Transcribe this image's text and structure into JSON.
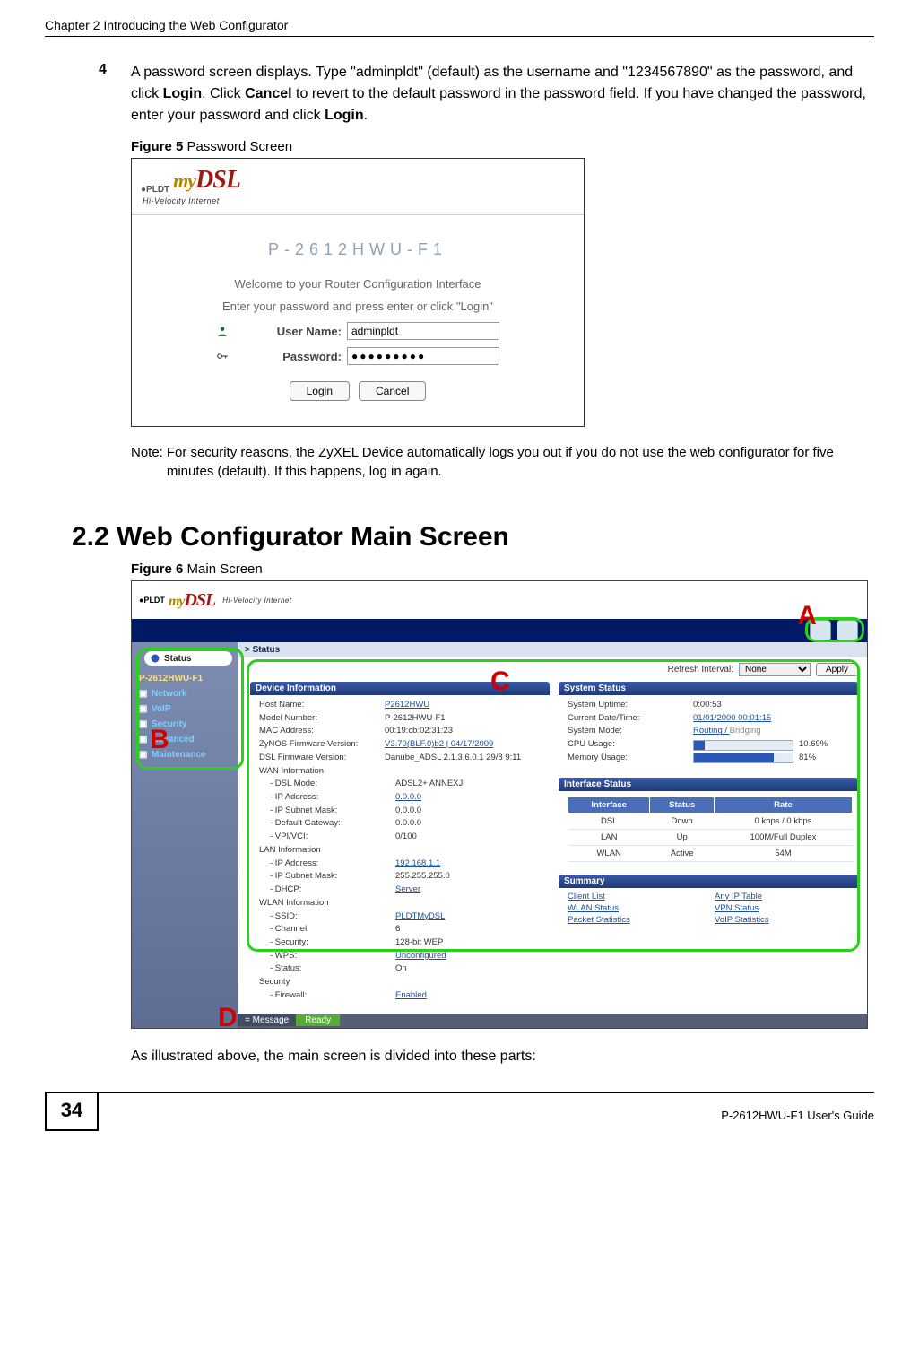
{
  "running_head": "Chapter 2 Introducing the Web Configurator",
  "step": {
    "num": "4",
    "text_before_login": "A password screen displays. Type \"adminpldt\" (default) as the username and \"1234567890\" as the password, and click ",
    "login_word": "Login",
    "text_mid": ". Click ",
    "cancel_word": "Cancel",
    "text_after_cancel": " to revert to the default password in the password field. If you have changed the password, enter your password and click ",
    "login_word_2": "Login",
    "period": "."
  },
  "figure5": {
    "label_bold": "Figure 5",
    "label_rest": "   Password Screen",
    "pldt": "●PLDT",
    "mydsl_my": "my",
    "mydsl_dsl": "DSL",
    "tagline": "Hi-Velocity Internet",
    "model": "P-2612HWU-F1",
    "welcome": "Welcome to your Router Configuration Interface",
    "instruction": "Enter your password and press enter or click \"Login\"",
    "user_label": "User Name:",
    "user_value": "adminpldt",
    "pass_label": "Password:",
    "pass_value": "●●●●●●●●●",
    "login_btn": "Login",
    "cancel_btn": "Cancel"
  },
  "note": {
    "label": "Note: ",
    "text": "For security reasons, the ZyXEL Device automatically logs you out if you do not use the web configurator for five minutes (default). If this happens, log in again."
  },
  "section_heading": "2.2  Web Configurator Main Screen",
  "figure6": {
    "label_bold": "Figure 6",
    "label_rest": "   Main Screen",
    "breadcrumb": "> Status",
    "refresh_label": "Refresh Interval:",
    "refresh_value": "None",
    "apply": "Apply",
    "sidebar": {
      "status": "Status",
      "model": "P-2612HWU-F1",
      "items": [
        "Network",
        "VoIP",
        "Security",
        "Advanced",
        "Maintenance"
      ]
    },
    "device_info": {
      "title": "Device Information",
      "rows": [
        {
          "label": "Host Name:",
          "value": "P2612HWU",
          "link": true
        },
        {
          "label": "Model Number:",
          "value": "P-2612HWU-F1"
        },
        {
          "label": "MAC Address:",
          "value": "00:19:cb:02:31:23"
        },
        {
          "label": "ZyNOS Firmware Version:",
          "value": "V3.70(BLF.0)b2 | 04/17/2009",
          "link": true
        },
        {
          "label": "DSL Firmware Version:",
          "value": "Danube_ADSL 2.1.3.6.0.1 29/8 9:11"
        },
        {
          "label": "WAN Information"
        },
        {
          "label": "- DSL Mode:",
          "value": "ADSL2+ ANNEXJ",
          "indent": true
        },
        {
          "label": "- IP Address:",
          "value": "0.0.0.0",
          "indent": true,
          "link": true
        },
        {
          "label": "- IP Subnet Mask:",
          "value": "0.0.0.0",
          "indent": true
        },
        {
          "label": "- Default Gateway:",
          "value": "0.0.0.0",
          "indent": true
        },
        {
          "label": "- VPI/VCI:",
          "value": "0/100",
          "indent": true
        },
        {
          "label": "LAN Information"
        },
        {
          "label": "- IP Address:",
          "value": "192.168.1.1",
          "indent": true,
          "link": true
        },
        {
          "label": "- IP Subnet Mask:",
          "value": "255.255.255.0",
          "indent": true
        },
        {
          "label": "- DHCP:",
          "value": "Server",
          "indent": true,
          "link": true
        },
        {
          "label": "WLAN Information"
        },
        {
          "label": "- SSID:",
          "value": "PLDTMyDSL",
          "indent": true,
          "link": true
        },
        {
          "label": "- Channel:",
          "value": "6",
          "indent": true
        },
        {
          "label": "- Security:",
          "value": "128-bit WEP",
          "indent": true
        },
        {
          "label": "- WPS:",
          "value": "Unconfigured",
          "indent": true,
          "link": true
        },
        {
          "label": "- Status:",
          "value": "On",
          "indent": true
        },
        {
          "label": "Security"
        },
        {
          "label": "- Firewall:",
          "value": "Enabled",
          "indent": true,
          "link": true
        }
      ]
    },
    "system_status": {
      "title": "System Status",
      "rows": [
        {
          "label": "System Uptime:",
          "value": "0:00:53"
        },
        {
          "label": "Current Date/Time:",
          "value": "01/01/2000 00:01:15",
          "link": true
        },
        {
          "label": "System Mode:",
          "value": "Routing / Bridging",
          "split": true
        },
        {
          "label": "CPU Usage:",
          "value": "10.69%",
          "bar": 11
        },
        {
          "label": "Memory Usage:",
          "value": "81%",
          "bar": 81
        }
      ]
    },
    "interface_status": {
      "title": "Interface Status",
      "headers": [
        "Interface",
        "Status",
        "Rate"
      ],
      "rows": [
        [
          "DSL",
          "Down",
          "0 kbps / 0 kbps"
        ],
        [
          "LAN",
          "Up",
          "100M/Full Duplex"
        ],
        [
          "WLAN",
          "Active",
          "54M"
        ]
      ]
    },
    "summary": {
      "title": "Summary",
      "links": [
        "Client List",
        "Any IP Table",
        "WLAN Status",
        "VPN Status",
        "Packet Statistics",
        "VoIP Statistics"
      ]
    },
    "message": {
      "label": "= Message",
      "value": "Ready"
    },
    "annot": {
      "A": "A",
      "B": "B",
      "C": "C",
      "D": "D"
    }
  },
  "post_figure": "As illustrated above, the main screen is divided into these parts:",
  "page_number": "34",
  "footer_guide": "P-2612HWU-F1 User's Guide"
}
